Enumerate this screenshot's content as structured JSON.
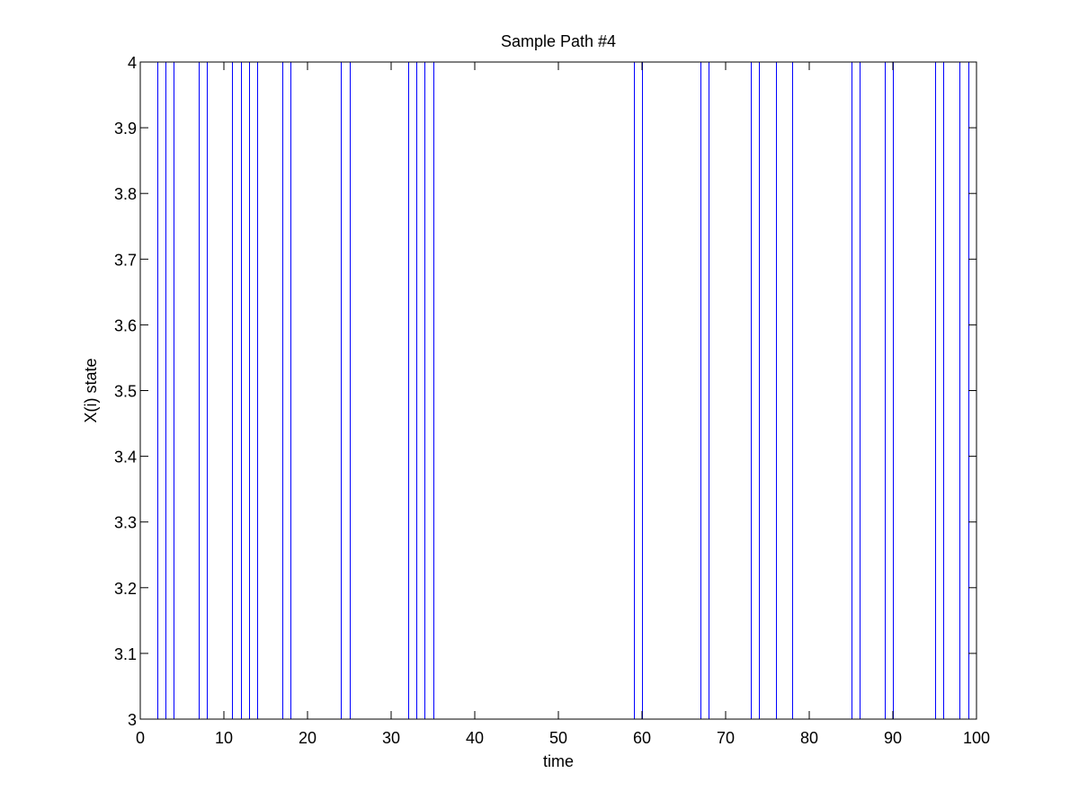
{
  "chart_data": {
    "type": "line",
    "title": "Sample Path #4",
    "xlabel": "time",
    "ylabel": "X(i) state",
    "xlim": [
      0,
      100
    ],
    "ylim": [
      3,
      4
    ],
    "x_ticks": [
      "0",
      "10",
      "20",
      "30",
      "40",
      "50",
      "60",
      "70",
      "80",
      "90",
      "100"
    ],
    "y_ticks": [
      "3",
      "3.1",
      "3.2",
      "3.3",
      "3.4",
      "3.5",
      "3.6",
      "3.7",
      "3.8",
      "3.9",
      "4"
    ],
    "grid": false,
    "series": [
      {
        "color": "#0000ff",
        "description": "state path alternating between 3 and 4; x values are the times of state changes",
        "x": [
          2,
          3,
          4,
          7,
          8,
          11,
          12,
          13,
          14,
          17,
          18,
          24,
          25,
          32,
          33,
          34,
          35,
          59,
          60,
          67,
          68,
          73,
          74,
          76,
          78,
          85,
          86,
          89,
          90,
          95,
          96,
          98,
          99
        ],
        "y": [
          3,
          4,
          3,
          4,
          3,
          4,
          3,
          4,
          3,
          4,
          3,
          4,
          3,
          4,
          3,
          4,
          3,
          4,
          3,
          4,
          3,
          4,
          3,
          4,
          3,
          4,
          3,
          4,
          3,
          4,
          3,
          4,
          3
        ]
      }
    ]
  }
}
